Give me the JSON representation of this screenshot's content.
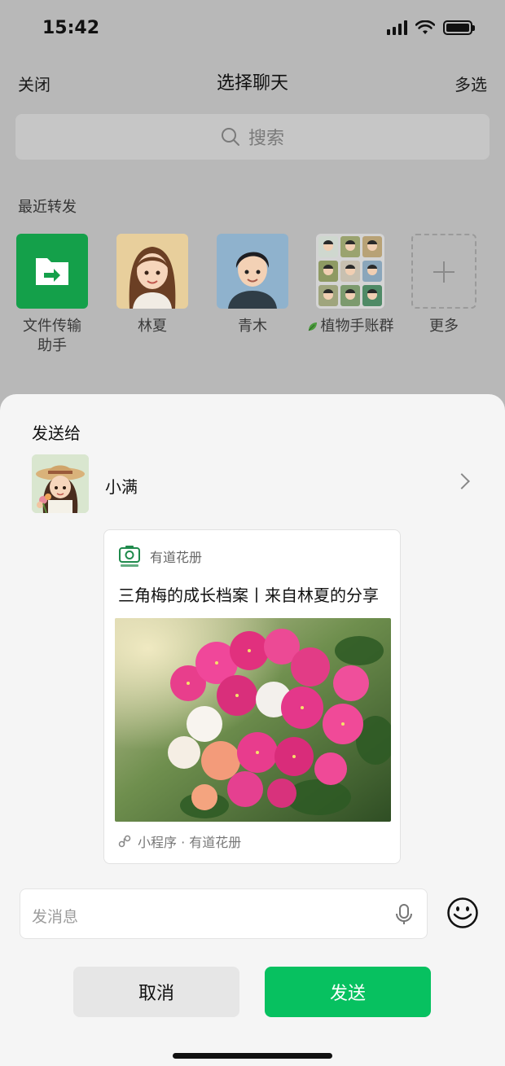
{
  "status_bar": {
    "time": "15:42"
  },
  "nav": {
    "close": "关闭",
    "title": "选择聊天",
    "multi_select": "多选"
  },
  "search": {
    "placeholder": "搜索"
  },
  "recent": {
    "title": "最近转发",
    "items": [
      {
        "label": "文件传输\n助手",
        "icon": "folder-transfer-icon"
      },
      {
        "label": "林夏",
        "icon": "avatar-girl"
      },
      {
        "label": "青木",
        "icon": "avatar-boy"
      },
      {
        "label": "植物手账群",
        "icon": "group-avatar-grid"
      },
      {
        "label": "更多",
        "icon": "plus-icon"
      }
    ]
  },
  "sheet": {
    "title": "发送给",
    "recipient": {
      "name": "小满"
    },
    "card": {
      "app_name": "有道花册",
      "title": "三角梅的成长档案丨来自林夏的分享",
      "footer": "小程序 · 有道花册"
    },
    "message": {
      "placeholder": "发消息"
    },
    "cancel_label": "取消",
    "send_label": "发送"
  },
  "colors": {
    "accent": "#07c160",
    "sheet_bg": "#f5f5f5",
    "overlay_bg": "#b8b8b8"
  }
}
